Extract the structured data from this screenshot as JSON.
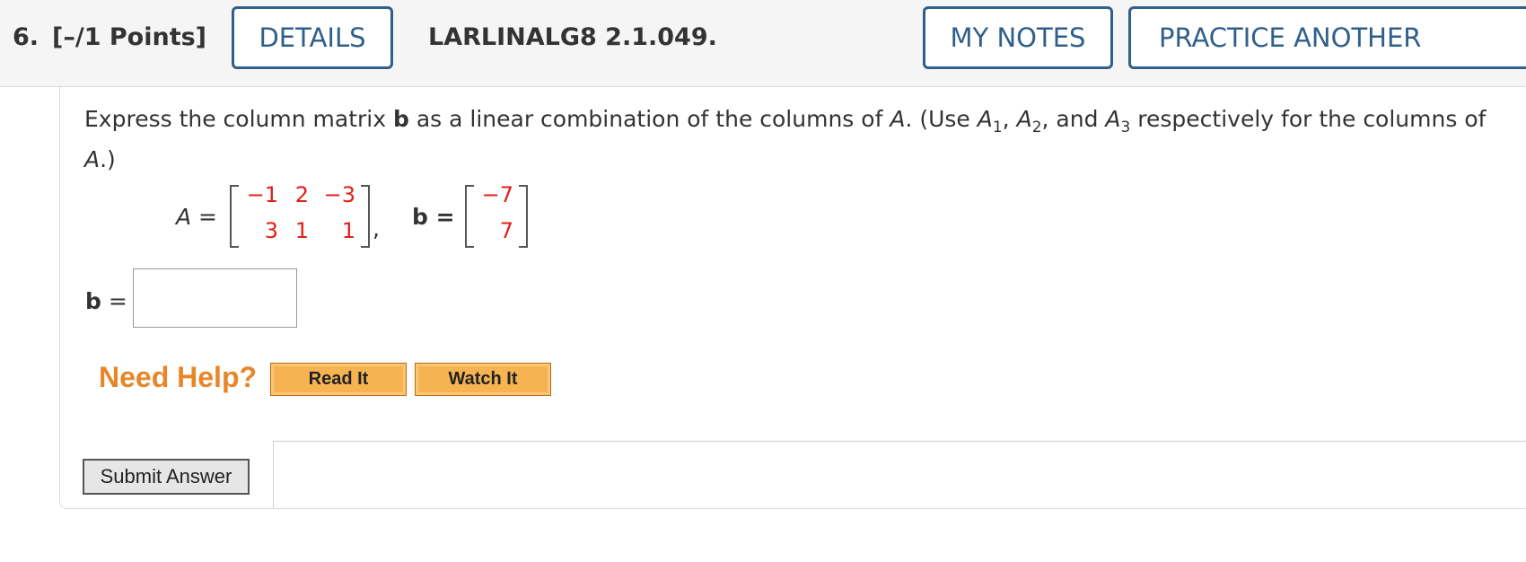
{
  "header": {
    "question_number": "6.",
    "points": "[–/1 Points]",
    "details_label": "DETAILS",
    "question_id": "LARLINALG8 2.1.049.",
    "my_notes_label": "MY NOTES",
    "practice_label": "PRACTICE ANOTHER"
  },
  "question": {
    "prompt_line1_pre": "Express the column matrix ",
    "prompt_bold_b": "b",
    "prompt_line1_mid": " as a linear combination of the columns of ",
    "prompt_A": "A",
    "prompt_use": ". (Use ",
    "prompt_A1": "A",
    "prompt_sub1": "1",
    "prompt_sep1": ", ",
    "prompt_A2": "A",
    "prompt_sub2": "2",
    "prompt_and": ", and ",
    "prompt_A3": "A",
    "prompt_sub3": "3",
    "prompt_tail": " respectively for the columns of ",
    "prompt_A_end": "A",
    "prompt_close": ".)",
    "matrix_A_label": "A =",
    "matrix_A": [
      [
        "−1",
        "2",
        "−3"
      ],
      [
        "3",
        "1",
        "1"
      ]
    ],
    "comma": ",",
    "matrix_b_label": "b =",
    "matrix_b": [
      "−7",
      "7"
    ],
    "answer_label": "b",
    "answer_eq": "=",
    "answer_value": ""
  },
  "help": {
    "need_help": "Need Help?",
    "read_it": "Read It",
    "watch_it": "Watch It"
  },
  "submit_label": "Submit Answer",
  "colors": {
    "accent": "#2f5f8a",
    "matrix_values": "#e0201a",
    "need_help": "#e8862a",
    "help_button": "#f6b352"
  }
}
